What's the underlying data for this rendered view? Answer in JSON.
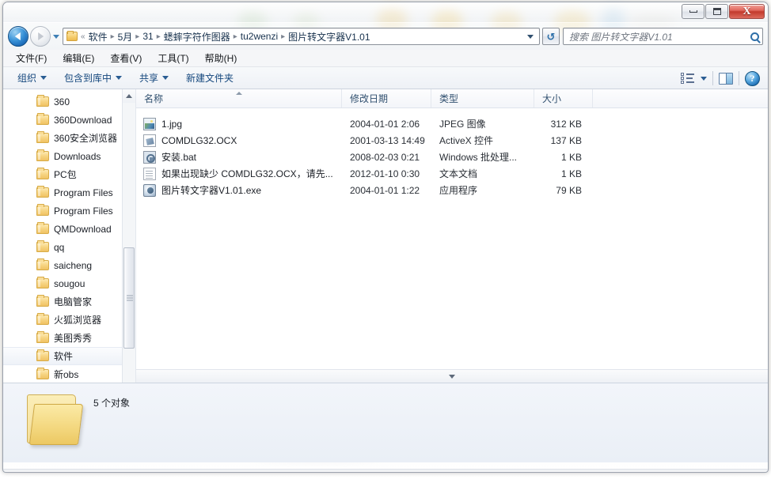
{
  "window": {
    "controls": {
      "minimize": "–",
      "maximize": "□",
      "close": "X"
    }
  },
  "navigation": {
    "back_icon": "back-arrow-icon",
    "forward_icon": "forward-arrow-icon",
    "recent_pages_icon": "chevron-down-icon",
    "refresh_icon": "refresh-icon",
    "refresh_glyph": "↺"
  },
  "address": {
    "root_prefix": "«",
    "crumbs": [
      "软件",
      "5月",
      "31",
      "蟋蟀字符作图器",
      "tu2wenzi",
      "图片转文字器V1.01"
    ],
    "separator": "▸",
    "dropdown_icon": "chevron-down-icon"
  },
  "search": {
    "placeholder": "搜索 图片转文字器V1.01",
    "value": "",
    "icon": "search-icon"
  },
  "menubar": {
    "items": [
      {
        "label": "文件(F)"
      },
      {
        "label": "编辑(E)"
      },
      {
        "label": "查看(V)"
      },
      {
        "label": "工具(T)"
      },
      {
        "label": "帮助(H)"
      }
    ]
  },
  "toolbar": {
    "organize": "组织",
    "include_in_library": "包含到库中",
    "share": "共享",
    "new_folder": "新建文件夹",
    "view_icon": "list-view-icon",
    "view_caret_icon": "chevron-down-icon",
    "preview_pane_icon": "preview-pane-icon",
    "help_icon": "help-icon",
    "help_glyph": "?"
  },
  "sidebar": {
    "items": [
      {
        "label": "360",
        "selected": false
      },
      {
        "label": "360Download",
        "selected": false
      },
      {
        "label": "360安全浏览器",
        "selected": false
      },
      {
        "label": "Downloads",
        "selected": false
      },
      {
        "label": "PC包",
        "selected": false
      },
      {
        "label": "Program Files",
        "selected": false
      },
      {
        "label": "Program Files",
        "selected": false
      },
      {
        "label": "QMDownload",
        "selected": false
      },
      {
        "label": "qq",
        "selected": false
      },
      {
        "label": "saicheng",
        "selected": false
      },
      {
        "label": "sougou",
        "selected": false
      },
      {
        "label": "电脑管家",
        "selected": false
      },
      {
        "label": "火狐浏览器",
        "selected": false
      },
      {
        "label": "美图秀秀",
        "selected": false
      },
      {
        "label": "软件",
        "selected": true
      },
      {
        "label": "新obs",
        "selected": false
      }
    ],
    "scroll_up_icon": "scroll-up-arrow-icon",
    "scroll_thumb": "scrollbar-thumb"
  },
  "filelist": {
    "columns": [
      {
        "key": "name",
        "label": "名称",
        "sorted": "asc"
      },
      {
        "key": "date",
        "label": "修改日期",
        "sorted": ""
      },
      {
        "key": "type",
        "label": "类型",
        "sorted": ""
      },
      {
        "key": "size",
        "label": "大小",
        "sorted": ""
      }
    ],
    "rows": [
      {
        "icon": "image-file-icon",
        "name": "1.jpg",
        "date": "2004-01-01 2:06",
        "type": "JPEG 图像",
        "size": "312 KB"
      },
      {
        "icon": "ocx-file-icon",
        "name": "COMDLG32.OCX",
        "date": "2001-03-13 14:49",
        "type": "ActiveX 控件",
        "size": "137 KB"
      },
      {
        "icon": "batch-file-icon",
        "name": "安装.bat",
        "date": "2008-02-03 0:21",
        "type": "Windows 批处理...",
        "size": "1 KB"
      },
      {
        "icon": "text-file-icon",
        "name": "如果出现缺少 COMDLG32.OCX，请先...",
        "date": "2012-01-10 0:30",
        "type": "文本文档",
        "size": "1 KB"
      },
      {
        "icon": "exe-file-icon",
        "name": "图片转文字器V1.01.exe",
        "date": "2004-01-01 1:22",
        "type": "应用程序",
        "size": "79 KB"
      }
    ],
    "scroll_down_icon": "scroll-down-arrow-icon"
  },
  "statusbar": {
    "folder_icon": "open-folder-icon",
    "item_count_text": "5 个对象"
  },
  "colors": {
    "accent_blue": "#14477d",
    "close_red": "#c23a2d",
    "folder_yellow": "#f3d77e"
  }
}
